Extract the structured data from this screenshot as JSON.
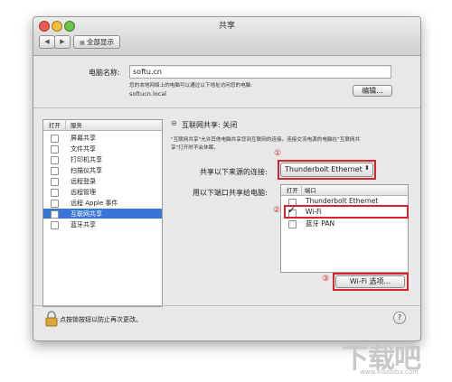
{
  "window": {
    "title": "共享",
    "show_all": "全部显示"
  },
  "computer": {
    "label": "电脑名称:",
    "name": "softu.cn",
    "description": "您的本地网络上的电脑可以通过以下地址访问您的电脑:",
    "local_address": "softucn.local",
    "edit_button": "编辑..."
  },
  "services": {
    "col_on": "打开",
    "col_service": "服务",
    "items": [
      {
        "label": "屏幕共享"
      },
      {
        "label": "文件共享"
      },
      {
        "label": "打印机共享"
      },
      {
        "label": "扫描仪共享"
      },
      {
        "label": "远程登录"
      },
      {
        "label": "远程管理"
      },
      {
        "label": "远程 Apple 事件"
      },
      {
        "label": "互联网共享"
      },
      {
        "label": "蓝牙共享"
      }
    ]
  },
  "internet_sharing": {
    "status": "互联网共享: 关闭",
    "desc_line1": "\"互联网共享\"允许其他电脑共享您到互联网的连接。连接交流电源的电脑在\"互联网共",
    "desc_line2": "享\"打开时不会休眠。",
    "share_from_label": "共享以下来源的连接:",
    "share_from_value": "Thunderbolt Ethernet",
    "to_ports_label": "用以下端口共享给电脑:",
    "ports_col_on": "打开",
    "ports_col_port": "端口",
    "ports": [
      {
        "label": "Thunderbolt Ethernet"
      },
      {
        "label": "Wi-Fi"
      },
      {
        "label": "蓝牙 PAN"
      }
    ],
    "wifi_options_button": "Wi-Fi 选项..."
  },
  "footer": {
    "lock_text": "点按锁按钮以防止再次更改。",
    "help": "?"
  },
  "annotations": {
    "c1": "①",
    "c2": "②",
    "c3": "③"
  },
  "watermark": {
    "logo": "下载吧",
    "url": "www.xiazaiba.com"
  },
  "colors": {
    "selection": "#3875d7",
    "annotation": "#d7262b",
    "window_bg": "#e8e8e8"
  }
}
